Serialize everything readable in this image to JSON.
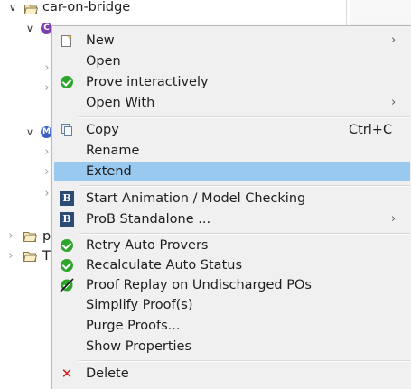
{
  "tree": {
    "project_label": "car-on-bridge",
    "row_p_label": "p",
    "row_t_label": "T"
  },
  "menu": {
    "items": [
      {
        "label": "New",
        "shortcut": "",
        "submenu": true
      },
      {
        "label": "Open",
        "shortcut": "",
        "submenu": false
      },
      {
        "label": "Prove interactively",
        "shortcut": "",
        "submenu": false
      },
      {
        "label": "Open With",
        "shortcut": "",
        "submenu": true
      },
      {
        "label": "Copy",
        "shortcut": "Ctrl+C",
        "submenu": false
      },
      {
        "label": "Rename",
        "shortcut": "",
        "submenu": false
      },
      {
        "label": "Extend",
        "shortcut": "",
        "submenu": false
      },
      {
        "label": "Start Animation / Model Checking",
        "shortcut": "",
        "submenu": false
      },
      {
        "label": "ProB Standalone ...",
        "shortcut": "",
        "submenu": true
      },
      {
        "label": "Retry Auto Provers",
        "shortcut": "",
        "submenu": false
      },
      {
        "label": "Recalculate Auto Status",
        "shortcut": "",
        "submenu": false
      },
      {
        "label": "Proof Replay on Undischarged POs",
        "shortcut": "",
        "submenu": false
      },
      {
        "label": "Simplify Proof(s)",
        "shortcut": "",
        "submenu": false
      },
      {
        "label": "Purge Proofs...",
        "shortcut": "",
        "submenu": false
      },
      {
        "label": "Show Properties",
        "shortcut": "",
        "submenu": false
      },
      {
        "label": "Delete",
        "shortcut": "",
        "submenu": false
      }
    ],
    "submenu_glyph": "›",
    "highlighted_item": "Extend",
    "colors": {
      "highlight": "#99c9ef",
      "menu_bg": "#f0f0f0",
      "check_green": "#2da52a",
      "delete_red": "#d0201b"
    }
  }
}
